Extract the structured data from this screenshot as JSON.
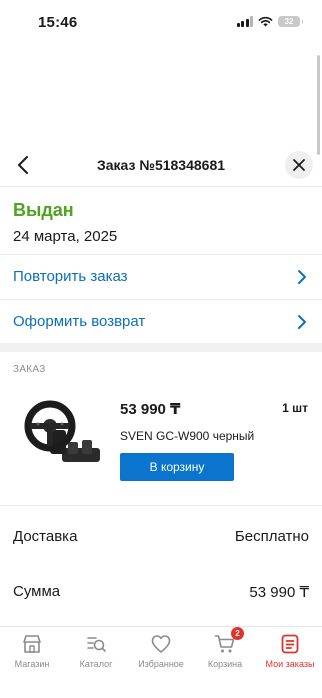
{
  "status_bar": {
    "time": "15:46",
    "battery": "32"
  },
  "header": {
    "title": "Заказ №518348681"
  },
  "order": {
    "status": "Выдан",
    "date": "24 марта, 2025"
  },
  "actions": [
    {
      "label": "Повторить заказ"
    },
    {
      "label": "Оформить возврат"
    }
  ],
  "items_section": {
    "label": "ЗАКАЗ",
    "product": {
      "price": "53 990 ₸",
      "quantity": "1 шт",
      "name": "SVEN GC-W900 черный",
      "cart_button": "В корзину"
    }
  },
  "summary": {
    "delivery_label": "Доставка",
    "delivery_value": "Бесплатно",
    "total_label": "Сумма",
    "total_value": "53 990 ₸"
  },
  "tabs": [
    {
      "label": "Магазин",
      "icon": "shop-icon"
    },
    {
      "label": "Каталог",
      "icon": "catalog-search-icon"
    },
    {
      "label": "Избранное",
      "icon": "heart-icon"
    },
    {
      "label": "Корзина",
      "icon": "cart-icon",
      "badge": "2"
    },
    {
      "label": "Мои заказы",
      "icon": "orders-icon",
      "active": true
    }
  ],
  "colors": {
    "accent_blue": "#0c6fb8",
    "button_blue": "#0b74cc",
    "status_green": "#4ea31f",
    "active_red": "#e0312a"
  }
}
